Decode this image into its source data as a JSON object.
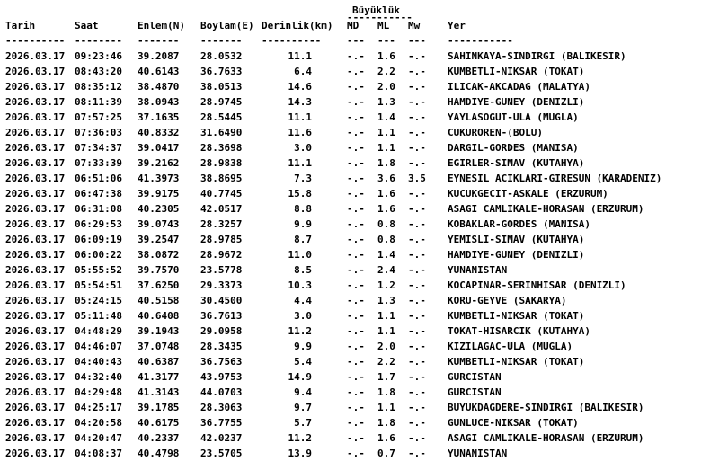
{
  "header": {
    "magnitude_group": "Büyüklük",
    "magnitude_group_rule": "-----------",
    "columns": [
      "Tarih",
      "Saat",
      "Enlem(N)",
      "Boylam(E)",
      "Derinlik(km)",
      "MD",
      "ML",
      "Mw",
      "Yer"
    ],
    "rules": [
      "----------",
      "--------",
      "-------",
      "-------",
      "----------",
      "---",
      "---",
      "---",
      "-----------"
    ]
  },
  "rows": [
    {
      "date": "2026.03.17",
      "time": "09:23:46",
      "lat": "39.2087",
      "lon": "28.0532",
      "depth": "11.1",
      "md": "-.-",
      "ml": "1.6",
      "mw": "-.-",
      "place": "SAHINKAYA-SINDIRGI (BALIKESIR)"
    },
    {
      "date": "2026.03.17",
      "time": "08:43:20",
      "lat": "40.6143",
      "lon": "36.7633",
      "depth": "6.4",
      "md": "-.-",
      "ml": "2.2",
      "mw": "-.-",
      "place": "KUMBETLI-NIKSAR (TOKAT)"
    },
    {
      "date": "2026.03.17",
      "time": "08:35:12",
      "lat": "38.4870",
      "lon": "38.0513",
      "depth": "14.6",
      "md": "-.-",
      "ml": "2.0",
      "mw": "-.-",
      "place": "ILICAK-AKCADAG (MALATYA)"
    },
    {
      "date": "2026.03.17",
      "time": "08:11:39",
      "lat": "38.0943",
      "lon": "28.9745",
      "depth": "14.3",
      "md": "-.-",
      "ml": "1.3",
      "mw": "-.-",
      "place": "HAMDIYE-GUNEY (DENIZLI)"
    },
    {
      "date": "2026.03.17",
      "time": "07:57:25",
      "lat": "37.1635",
      "lon": "28.5445",
      "depth": "11.1",
      "md": "-.-",
      "ml": "1.4",
      "mw": "-.-",
      "place": "YAYLASOGUT-ULA (MUGLA)"
    },
    {
      "date": "2026.03.17",
      "time": "07:36:03",
      "lat": "40.8332",
      "lon": "31.6490",
      "depth": "11.6",
      "md": "-.-",
      "ml": "1.1",
      "mw": "-.-",
      "place": "CUKUROREN-(BOLU)"
    },
    {
      "date": "2026.03.17",
      "time": "07:34:37",
      "lat": "39.0417",
      "lon": "28.3698",
      "depth": "3.0",
      "md": "-.-",
      "ml": "1.1",
      "mw": "-.-",
      "place": "DARGIL-GORDES (MANISA)"
    },
    {
      "date": "2026.03.17",
      "time": "07:33:39",
      "lat": "39.2162",
      "lon": "28.9838",
      "depth": "11.1",
      "md": "-.-",
      "ml": "1.8",
      "mw": "-.-",
      "place": "EGIRLER-SIMAV (KUTAHYA)"
    },
    {
      "date": "2026.03.17",
      "time": "06:51:06",
      "lat": "41.3973",
      "lon": "38.8695",
      "depth": "7.3",
      "md": "-.-",
      "ml": "3.6",
      "mw": "3.5",
      "place": "EYNESIL ACIKLARI-GIRESUN (KARADENIZ)"
    },
    {
      "date": "2026.03.17",
      "time": "06:47:38",
      "lat": "39.9175",
      "lon": "40.7745",
      "depth": "15.8",
      "md": "-.-",
      "ml": "1.6",
      "mw": "-.-",
      "place": "KUCUKGECIT-ASKALE (ERZURUM)"
    },
    {
      "date": "2026.03.17",
      "time": "06:31:08",
      "lat": "40.2305",
      "lon": "42.0517",
      "depth": "8.8",
      "md": "-.-",
      "ml": "1.6",
      "mw": "-.-",
      "place": "ASAGI CAMLIKALE-HORASAN (ERZURUM)"
    },
    {
      "date": "2026.03.17",
      "time": "06:29:53",
      "lat": "39.0743",
      "lon": "28.3257",
      "depth": "9.9",
      "md": "-.-",
      "ml": "0.8",
      "mw": "-.-",
      "place": "KOBAKLAR-GORDES (MANISA)"
    },
    {
      "date": "2026.03.17",
      "time": "06:09:19",
      "lat": "39.2547",
      "lon": "28.9785",
      "depth": "8.7",
      "md": "-.-",
      "ml": "0.8",
      "mw": "-.-",
      "place": "YEMISLI-SIMAV (KUTAHYA)"
    },
    {
      "date": "2026.03.17",
      "time": "06:00:22",
      "lat": "38.0872",
      "lon": "28.9672",
      "depth": "11.0",
      "md": "-.-",
      "ml": "1.4",
      "mw": "-.-",
      "place": "HAMDIYE-GUNEY (DENIZLI)"
    },
    {
      "date": "2026.03.17",
      "time": "05:55:52",
      "lat": "39.7570",
      "lon": "23.5778",
      "depth": "8.5",
      "md": "-.-",
      "ml": "2.4",
      "mw": "-.-",
      "place": "YUNANISTAN"
    },
    {
      "date": "2026.03.17",
      "time": "05:54:51",
      "lat": "37.6250",
      "lon": "29.3373",
      "depth": "10.3",
      "md": "-.-",
      "ml": "1.2",
      "mw": "-.-",
      "place": "KOCAPINAR-SERINHISAR (DENIZLI)"
    },
    {
      "date": "2026.03.17",
      "time": "05:24:15",
      "lat": "40.5158",
      "lon": "30.4500",
      "depth": "4.4",
      "md": "-.-",
      "ml": "1.3",
      "mw": "-.-",
      "place": "KORU-GEYVE (SAKARYA)"
    },
    {
      "date": "2026.03.17",
      "time": "05:11:48",
      "lat": "40.6408",
      "lon": "36.7613",
      "depth": "3.0",
      "md": "-.-",
      "ml": "1.1",
      "mw": "-.-",
      "place": "KUMBETLI-NIKSAR (TOKAT)"
    },
    {
      "date": "2026.03.17",
      "time": "04:48:29",
      "lat": "39.1943",
      "lon": "29.0958",
      "depth": "11.2",
      "md": "-.-",
      "ml": "1.1",
      "mw": "-.-",
      "place": "TOKAT-HISARCIK (KUTAHYA)"
    },
    {
      "date": "2026.03.17",
      "time": "04:46:07",
      "lat": "37.0748",
      "lon": "28.3435",
      "depth": "9.9",
      "md": "-.-",
      "ml": "2.0",
      "mw": "-.-",
      "place": "KIZILAGAC-ULA (MUGLA)"
    },
    {
      "date": "2026.03.17",
      "time": "04:40:43",
      "lat": "40.6387",
      "lon": "36.7563",
      "depth": "5.4",
      "md": "-.-",
      "ml": "2.2",
      "mw": "-.-",
      "place": "KUMBETLI-NIKSAR (TOKAT)"
    },
    {
      "date": "2026.03.17",
      "time": "04:32:40",
      "lat": "41.3177",
      "lon": "43.9753",
      "depth": "14.9",
      "md": "-.-",
      "ml": "1.7",
      "mw": "-.-",
      "place": "GURCISTAN"
    },
    {
      "date": "2026.03.17",
      "time": "04:29:48",
      "lat": "41.3143",
      "lon": "44.0703",
      "depth": "9.4",
      "md": "-.-",
      "ml": "1.8",
      "mw": "-.-",
      "place": "GURCISTAN"
    },
    {
      "date": "2026.03.17",
      "time": "04:25:17",
      "lat": "39.1785",
      "lon": "28.3063",
      "depth": "9.7",
      "md": "-.-",
      "ml": "1.1",
      "mw": "-.-",
      "place": "BUYUKDAGDERE-SINDIRGI (BALIKESIR)"
    },
    {
      "date": "2026.03.17",
      "time": "04:20:58",
      "lat": "40.6175",
      "lon": "36.7755",
      "depth": "5.7",
      "md": "-.-",
      "ml": "1.8",
      "mw": "-.-",
      "place": "GUNLUCE-NIKSAR (TOKAT)"
    },
    {
      "date": "2026.03.17",
      "time": "04:20:47",
      "lat": "40.2337",
      "lon": "42.0237",
      "depth": "11.2",
      "md": "-.-",
      "ml": "1.6",
      "mw": "-.-",
      "place": "ASAGI CAMLIKALE-HORASAN (ERZURUM)"
    },
    {
      "date": "2026.03.17",
      "time": "04:08:37",
      "lat": "40.4798",
      "lon": "23.5705",
      "depth": "13.9",
      "md": "-.-",
      "ml": "0.7",
      "mw": "-.-",
      "place": "YUNANISTAN"
    }
  ]
}
